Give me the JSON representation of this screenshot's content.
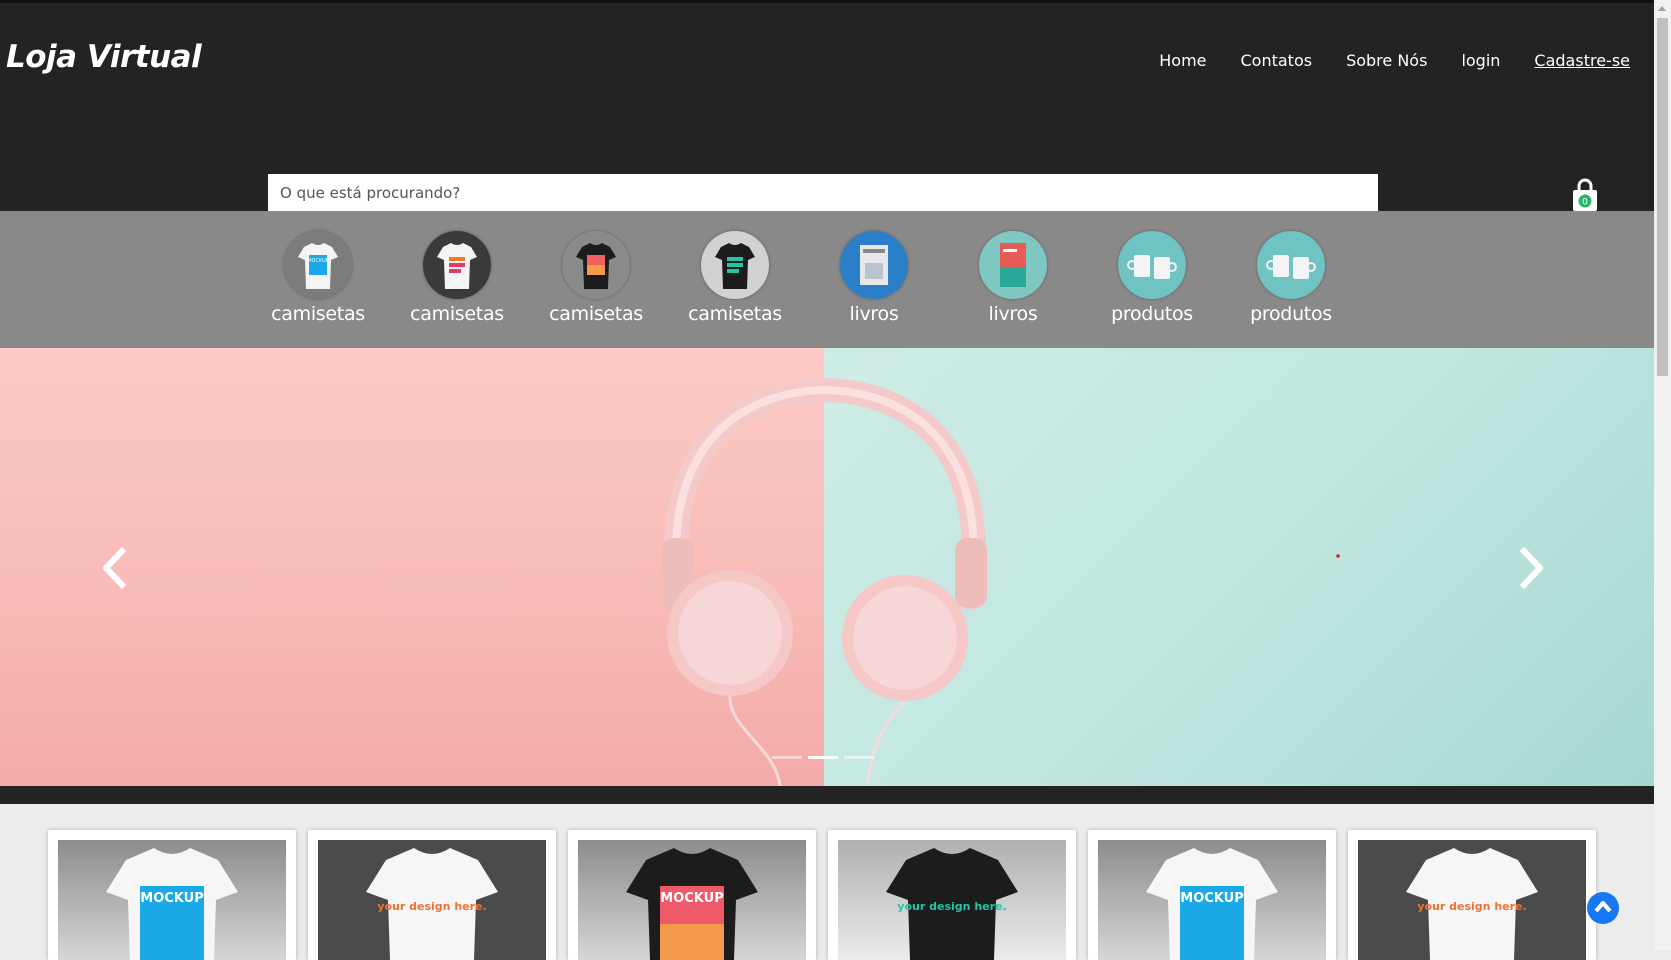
{
  "header": {
    "brand": "Loja Virtual",
    "nav": {
      "home": "Home",
      "contatos": "Contatos",
      "sobre": "Sobre Nós",
      "login": "login",
      "cadastro": "Cadastre-se"
    },
    "search": {
      "placeholder": "O que está procurando?"
    },
    "cart": {
      "count": "0",
      "icon": "shopping-bag-icon"
    }
  },
  "categories": [
    {
      "label": "camisetas",
      "thumb": "white-mockup-shirt"
    },
    {
      "label": "camisetas",
      "thumb": "white-design-shirt"
    },
    {
      "label": "camisetas",
      "thumb": "black-mockup-shirt"
    },
    {
      "label": "camisetas",
      "thumb": "black-design-shirt"
    },
    {
      "label": "livros",
      "thumb": "hardcover-book"
    },
    {
      "label": "livros",
      "thumb": "red-book"
    },
    {
      "label": "produtos",
      "thumb": "mugs"
    },
    {
      "label": "produtos",
      "thumb": "mugs"
    }
  ],
  "carousel": {
    "slide_count": 3,
    "active_slide": 2,
    "prev_icon": "chevron-left-icon",
    "next_icon": "chevron-right-icon"
  },
  "products": [
    {
      "thumb": "white-mockup-shirt",
      "print": "MOCKUP"
    },
    {
      "thumb": "white-design-shirt",
      "print": "your design here."
    },
    {
      "thumb": "black-mockup-shirt",
      "print": "MOCKUP"
    },
    {
      "thumb": "black-design-shirt",
      "print": "your design here."
    },
    {
      "thumb": "white-mockup-shirt",
      "print": "MOCKUP"
    },
    {
      "thumb": "white-design-shirt",
      "print": "your design here."
    }
  ],
  "colors": {
    "header_bg": "#232323",
    "category_bar": "#898989",
    "accent_blue": "#1877f2",
    "cart_badge": "#2fb36a"
  },
  "scroll_to_top_icon": "chevron-up-icon"
}
